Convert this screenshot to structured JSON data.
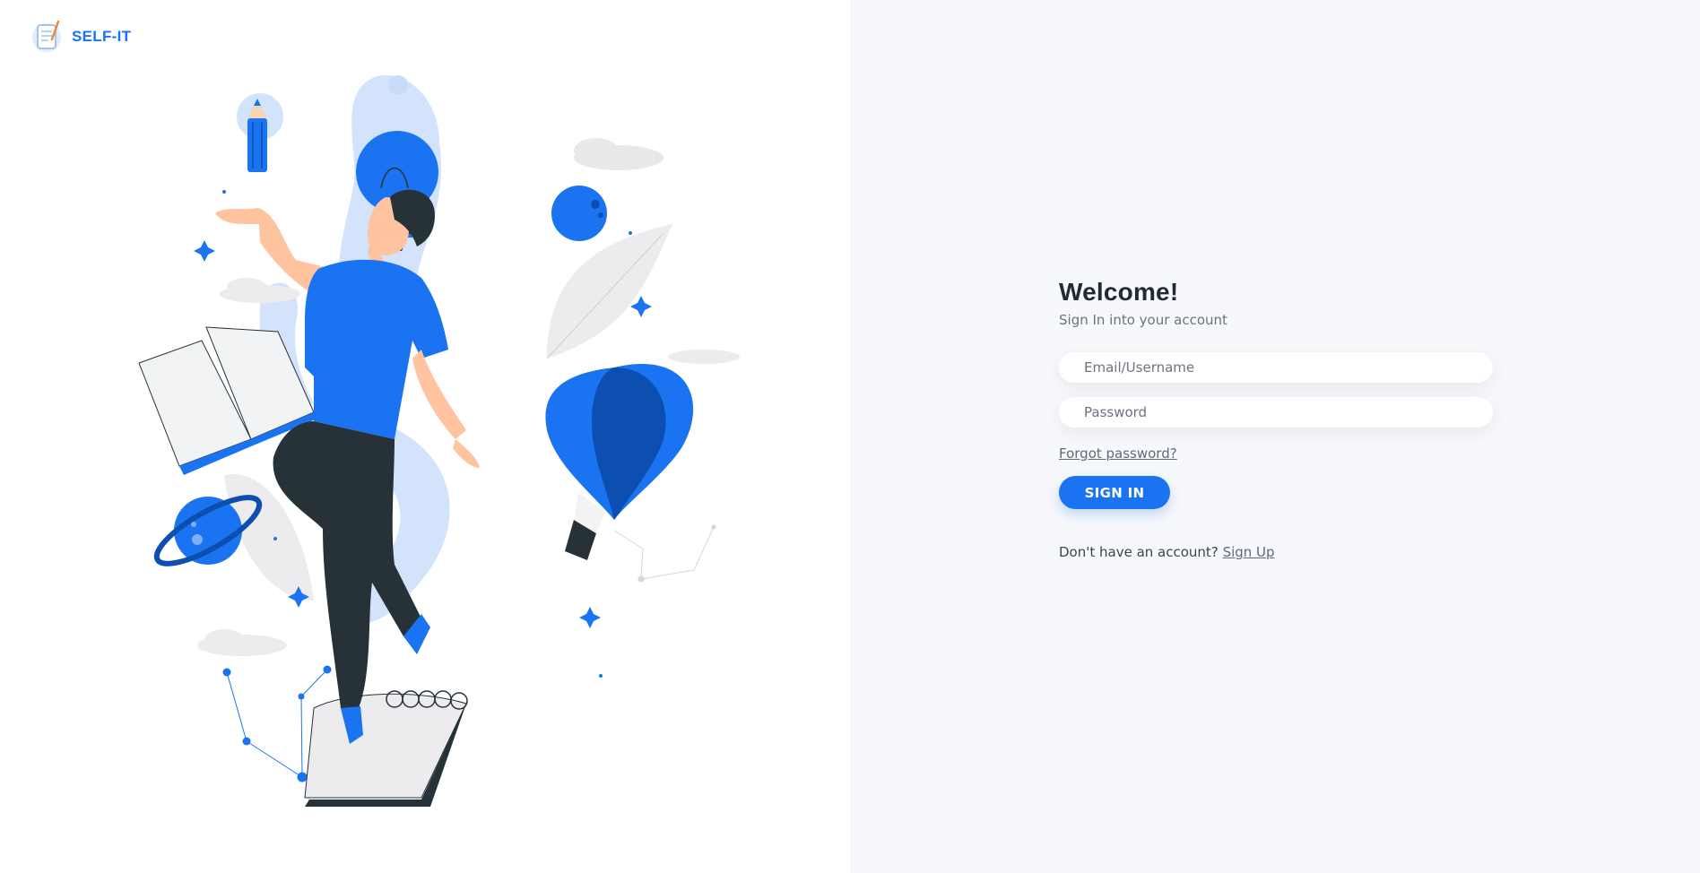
{
  "brand": {
    "name": "SELF-IT",
    "icon": "notebook-pencil-logo-icon",
    "accent": "#1a73f0"
  },
  "illustration": {
    "icon": "student-floating-illustration"
  },
  "login": {
    "title": "Welcome!",
    "subtitle": "Sign In into your account",
    "email_placeholder": "Email/Username",
    "email_value": "",
    "password_placeholder": "Password",
    "password_value": "",
    "forgot_label": "Forgot password?",
    "signin_label": "SIGN IN",
    "signup_prompt": "Don't have an account?",
    "signup_label": "Sign Up"
  },
  "colors": {
    "primary": "#1a73f0",
    "dark_text": "#1f2a37",
    "muted_text": "#6b7380",
    "panel_bg": "#f7f8fb"
  }
}
